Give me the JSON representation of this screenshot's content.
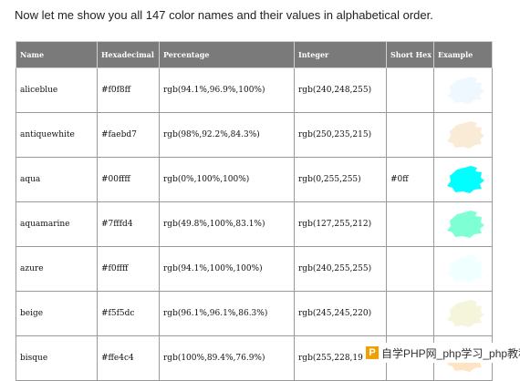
{
  "intro_text": "Now let me show you all 147 color names and their values in alphabetical order.",
  "table": {
    "headers": [
      "Name",
      "Hexadecimal",
      "Percentage",
      "Integer",
      "Short Hex",
      "Example"
    ],
    "rows": [
      {
        "name": "aliceblue",
        "hex": "#f0f8ff",
        "percentage": "rgb(94.1%,96.9%,100%)",
        "integer": "rgb(240,248,255)",
        "short_hex": "",
        "swatch_color": "#f0f8ff"
      },
      {
        "name": "antiquewhite",
        "hex": "#faebd7",
        "percentage": "rgb(98%,92.2%,84.3%)",
        "integer": "rgb(250,235,215)",
        "short_hex": "",
        "swatch_color": "#faebd7"
      },
      {
        "name": "aqua",
        "hex": "#00ffff",
        "percentage": "rgb(0%,100%,100%)",
        "integer": "rgb(0,255,255)",
        "short_hex": "#0ff",
        "swatch_color": "#00ffff"
      },
      {
        "name": "aquamarine",
        "hex": "#7fffd4",
        "percentage": "rgb(49.8%,100%,83.1%)",
        "integer": "rgb(127,255,212)",
        "short_hex": "",
        "swatch_color": "#7fffd4"
      },
      {
        "name": "azure",
        "hex": "#f0ffff",
        "percentage": "rgb(94.1%,100%,100%)",
        "integer": "rgb(240,255,255)",
        "short_hex": "",
        "swatch_color": "#f0ffff"
      },
      {
        "name": "beige",
        "hex": "#f5f5dc",
        "percentage": "rgb(96.1%,96.1%,86.3%)",
        "integer": "rgb(245,245,220)",
        "short_hex": "",
        "swatch_color": "#f5f5dc"
      },
      {
        "name": "bisque",
        "hex": "#ffe4c4",
        "percentage": "rgb(100%,89.4%,76.9%)",
        "integer": "rgb(255,228,196)",
        "short_hex": "",
        "swatch_color": "#ffe4c4"
      }
    ]
  },
  "watermark": {
    "logo_letter": "P",
    "text": "自学PHP网_php学习_php教程"
  }
}
